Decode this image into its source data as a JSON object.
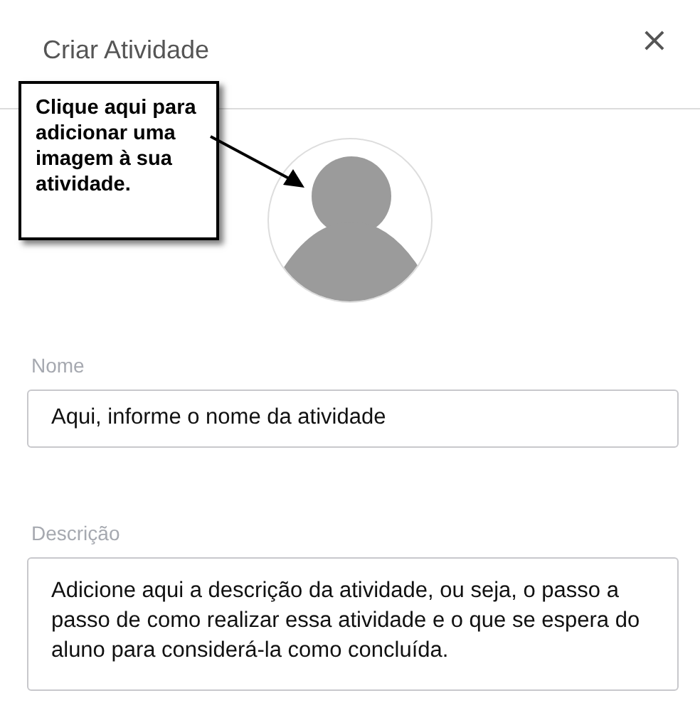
{
  "dialog": {
    "title": "Criar Atividade",
    "close": "×"
  },
  "callout": {
    "text": "Clique aqui para adicionar uma imagem à sua atividade."
  },
  "fields": [
    {
      "kind": "input",
      "label": "Nome",
      "value": "Aqui, informe o nome da atividade"
    },
    {
      "kind": "textarea",
      "label": "Descrição",
      "value": "Adicione aqui a descrição da atividade, ou seja, o passo a passo de como realizar essa atividade e o que se espera do aluno para considerá-la como concluída."
    }
  ]
}
